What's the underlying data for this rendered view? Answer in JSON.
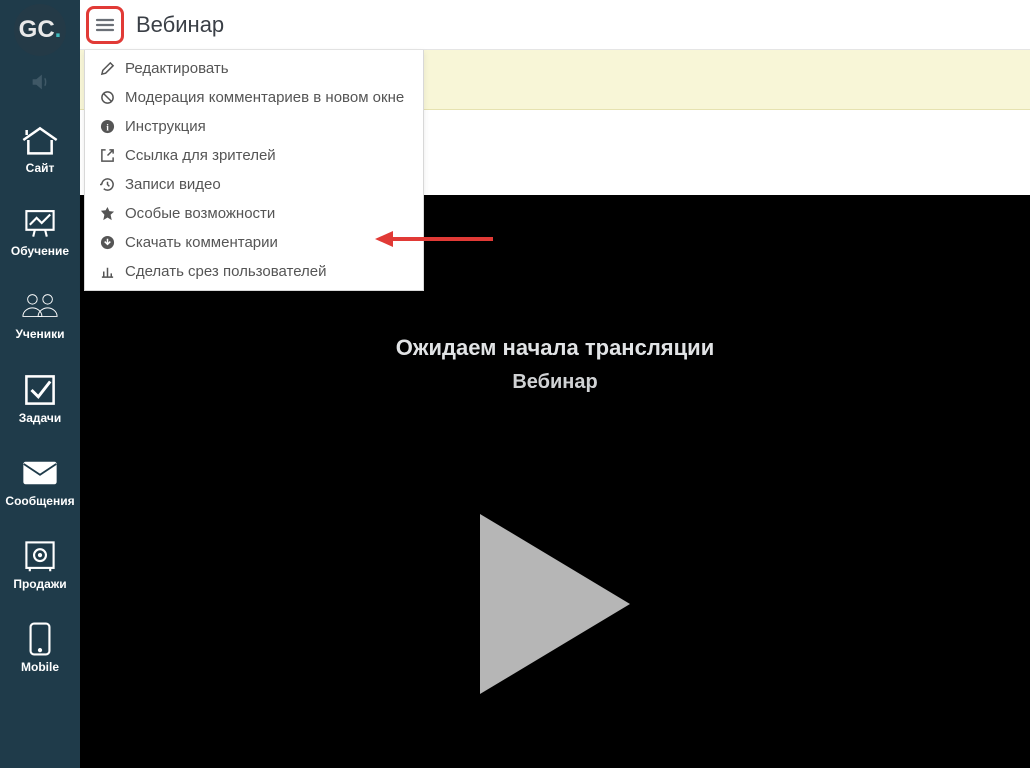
{
  "logo": {
    "text_g": "G",
    "text_c": "C",
    "text_dot": "."
  },
  "sidebar": {
    "items": [
      {
        "label": "Сайт"
      },
      {
        "label": "Обучение"
      },
      {
        "label": "Ученики"
      },
      {
        "label": "Задачи"
      },
      {
        "label": "Сообщения"
      },
      {
        "label": "Продажи"
      },
      {
        "label": "Mobile"
      }
    ]
  },
  "page": {
    "title": "Вебинар"
  },
  "dropdown": {
    "items": [
      {
        "label": "Редактировать"
      },
      {
        "label": "Модерация комментариев в новом окне"
      },
      {
        "label": "Инструкция"
      },
      {
        "label": "Ссылка для зрителей"
      },
      {
        "label": "Записи видео"
      },
      {
        "label": "Особые возможности"
      },
      {
        "label": "Скачать комментарии"
      },
      {
        "label": "Сделать срез пользователей"
      }
    ]
  },
  "video": {
    "waiting_line1": "Ожидаем начала трансляции",
    "waiting_line2": "Вебинар"
  }
}
